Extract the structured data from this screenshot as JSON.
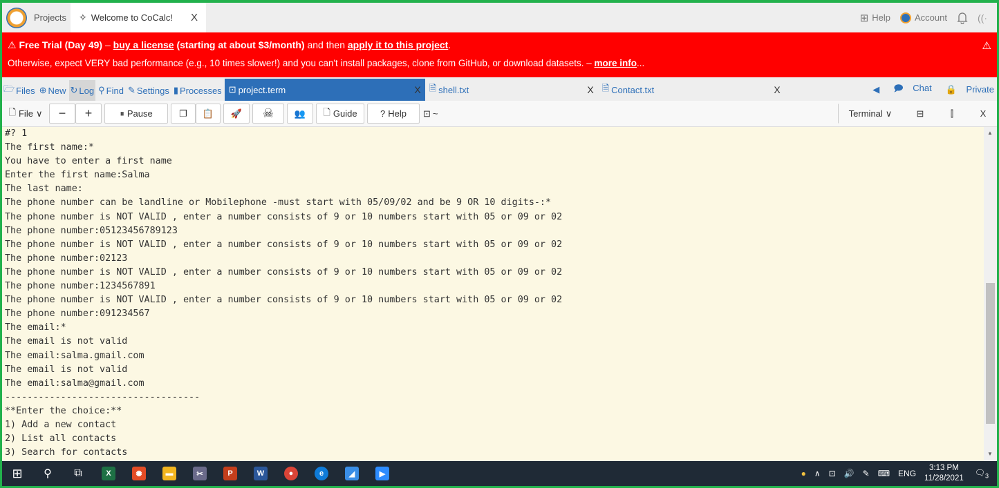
{
  "top_tabs": {
    "projects": "Projects",
    "welcome": "Welcome to CoCalc!",
    "welcome_close": "X",
    "help": "Help",
    "account": "Account"
  },
  "banner": {
    "warn_icon": "⚠",
    "line1_a": "Free Trial (Day 49)",
    "line1_b": " – ",
    "line1_link1": "buy a license",
    "line1_c": " (starting at about $3/month)",
    "line1_d": " and then ",
    "line1_link2": "apply it to this project",
    "line1_e": ".",
    "line2_a": "Otherwise, expect VERY bad performance (e.g., 10 times slower!) and you can't install packages, clone from GitHub, or download datasets. – ",
    "line2_link": "more info",
    "line2_b": "..."
  },
  "filebar": {
    "files": "Files",
    "new": "New",
    "log": "Log",
    "find": "Find",
    "settings": "Settings",
    "processes": "Processes",
    "tabs": [
      {
        "label": "project.term",
        "close": "X"
      },
      {
        "label": "shell.txt",
        "close": "X"
      },
      {
        "label": "Contact.txt",
        "close": "X"
      }
    ],
    "chat": "Chat",
    "private": "Private"
  },
  "toolbar": {
    "file": "File",
    "pause": "Pause",
    "guide": "Guide",
    "help": "Help",
    "path": "~",
    "terminal": "Terminal",
    "close": "X"
  },
  "terminal_lines": [
    "#? 1",
    "The first name:*",
    "You have to enter a first name",
    "Enter the first name:Salma",
    "The last name:",
    "The phone number can be landline or Mobilephone -must start with 05/09/02 and be 9 OR 10 digits-:*",
    "The phone number is NOT VALID , enter a number consists of 9 or 10 numbers start with 05 or 09 or 02",
    "The phone number:05123456789123",
    "The phone number is NOT VALID , enter a number consists of 9 or 10 numbers start with 05 or 09 or 02",
    "The phone number:02123",
    "The phone number is NOT VALID , enter a number consists of 9 or 10 numbers start with 05 or 09 or 02",
    "The phone number:1234567891",
    "The phone number is NOT VALID , enter a number consists of 9 or 10 numbers start with 05 or 09 or 02",
    "The phone number:091234567",
    "The email:*",
    "The email is not valid",
    "The email:salma.gmail.com",
    "The email is not valid",
    "The email:salma@gmail.com",
    "-----------------------------------",
    "**Enter the choice:**",
    "1) Add a new contact",
    "2) List all contacts",
    "3) Search for contacts"
  ],
  "taskbar": {
    "tray_lang": "ENG",
    "time": "3:13 PM",
    "date": "11/28/2021",
    "notif_count": "3"
  },
  "colors": {
    "banner_bg": "#ff0000",
    "active_tab": "#2d6fb8",
    "terminal_bg": "#fcf8e3",
    "frame": "#22b14c",
    "taskbar": "#1f2a36"
  }
}
